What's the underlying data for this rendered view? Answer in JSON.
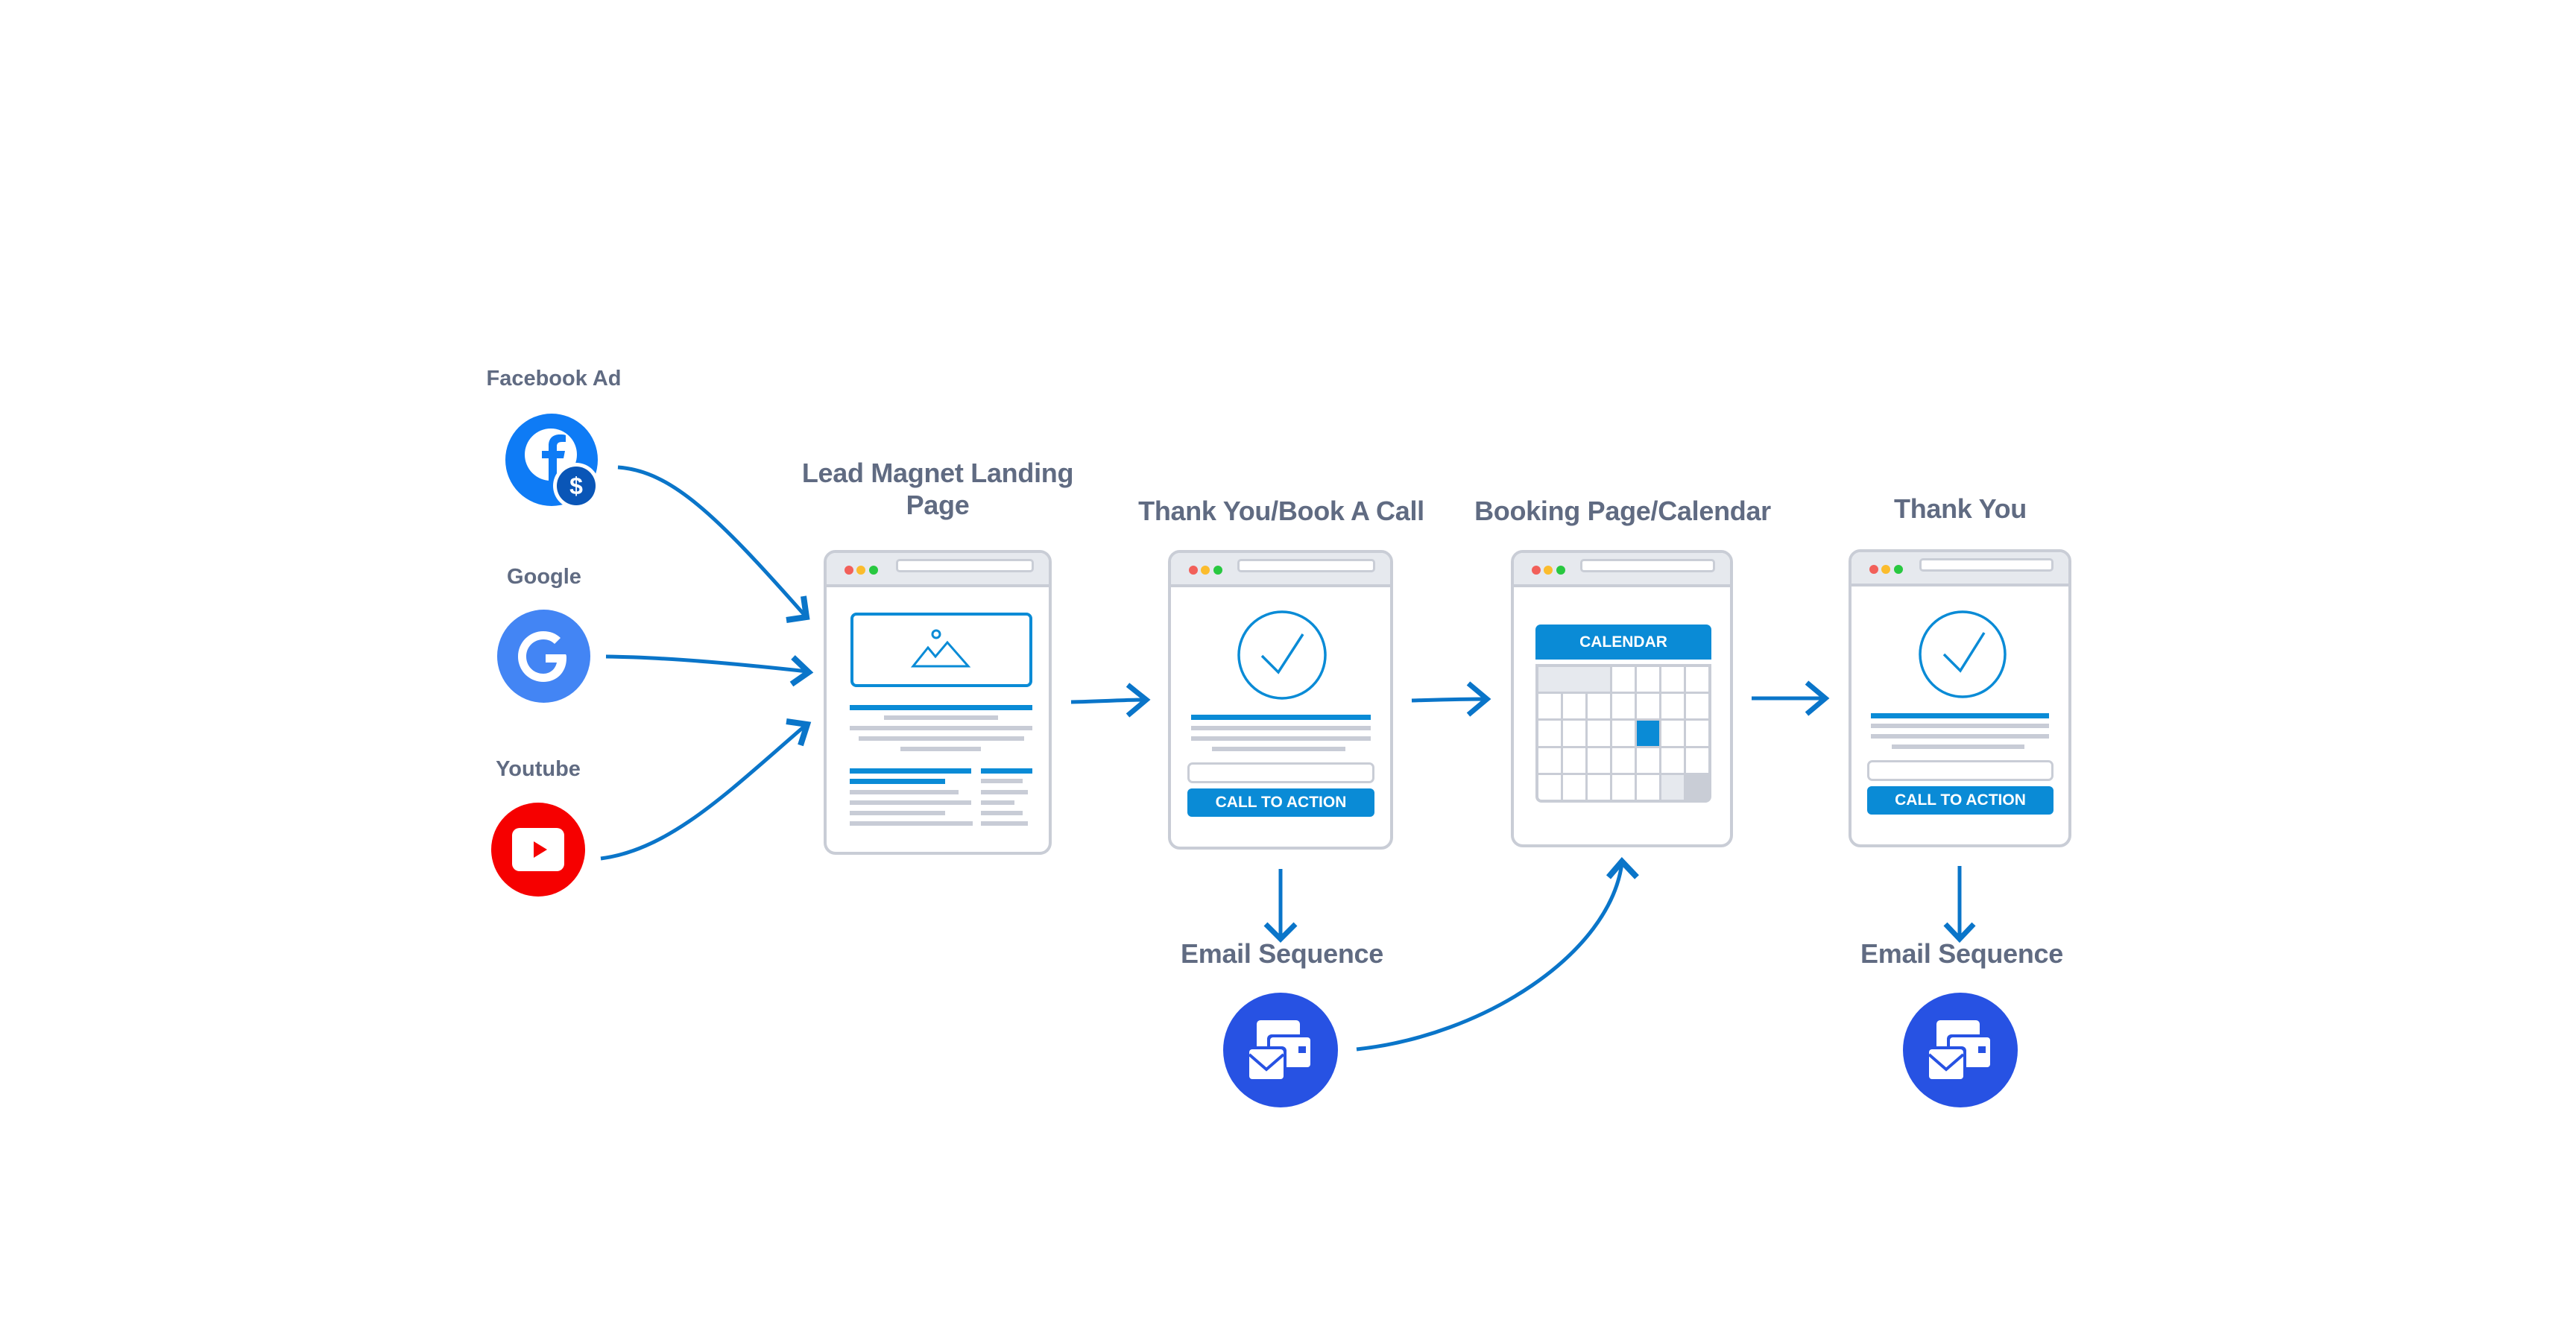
{
  "sources": [
    {
      "label": "Facebook Ad",
      "icon": "facebook-ad-icon",
      "color": "#0e7bf5",
      "badge_color": "#0a56b7",
      "badge_glyph": "$",
      "glyph": "f"
    },
    {
      "label": "Google",
      "icon": "google-icon",
      "color": "#4385f4",
      "glyph": "G"
    },
    {
      "label": "Youtube",
      "icon": "youtube-icon",
      "color": "#f60000"
    }
  ],
  "steps": [
    {
      "title_line1": "Lead Magnet Landing",
      "title_line2": "Page",
      "type": "landing-page"
    },
    {
      "title": "Thank You/Book A Call",
      "type": "thank-you-cta",
      "cta_label": "CALL TO ACTION"
    },
    {
      "title": "Booking Page/Calendar",
      "type": "calendar",
      "calendar_label": "CALENDAR"
    },
    {
      "title": "Thank You",
      "type": "thank-you-cta",
      "cta_label": "CALL TO ACTION"
    }
  ],
  "email_sequences": [
    {
      "label": "Email Sequence",
      "icon": "email-sequence-icon",
      "color": "#2752e3"
    },
    {
      "label": "Email Sequence",
      "icon": "email-sequence-icon",
      "color": "#2752e3"
    }
  ],
  "colors": {
    "arrow": "#0a75c9",
    "accent": "#0a8bd6",
    "label": "#606b82",
    "frame_border": "#c9cdd6"
  }
}
